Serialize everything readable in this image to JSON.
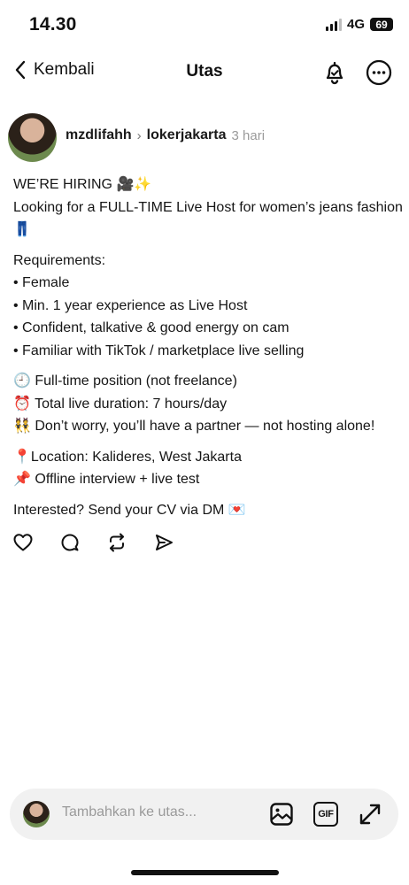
{
  "status_bar": {
    "time": "14.30",
    "network": "4G",
    "battery": "69"
  },
  "nav": {
    "back_label": "Kembali",
    "title": "Utas",
    "icons": [
      "chevron-left-icon",
      "bell-icon",
      "more-icon"
    ]
  },
  "post": {
    "username": "mzdlifahh",
    "community": "lokerjakarta",
    "timestamp": "3 hari",
    "lines": {
      "l1": "WE’RE HIRING 🎥✨",
      "l2": "Looking for a FULL-TIME Live Host for women’s jeans fashion 👖",
      "l3": "Requirements:",
      "l4": "• Female",
      "l5": "• Min. 1 year experience as Live Host",
      "l6": "• Confident, talkative & good energy on cam",
      "l7": "• Familiar with TikTok / marketplace live selling",
      "l8": "🕘 Full-time position (not freelance)",
      "l9": "⏰ Total live duration: 7 hours/day",
      "l10": "👯 Don’t worry, you’ll have a partner — not hosting alone!",
      "l11": "📍Location: Kalideres, West Jakarta",
      "l12": "📌 Offline interview + live test",
      "l13": "Interested? Send your CV via DM 💌"
    },
    "action_icons": [
      "heart-icon",
      "comment-icon",
      "repost-icon",
      "send-icon"
    ]
  },
  "composer": {
    "placeholder": "Tambahkan ke utas...",
    "gif_label": "GIF",
    "icons": [
      "image-icon",
      "gif-icon",
      "expand-icon"
    ]
  }
}
